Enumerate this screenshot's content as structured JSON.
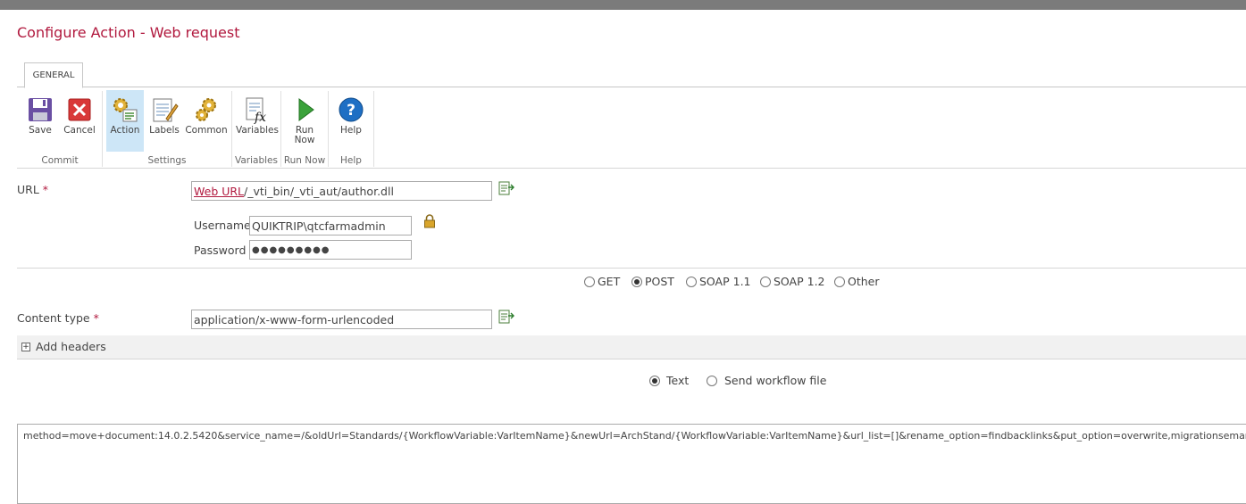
{
  "dialog": {
    "title": "Configure Action - Web request"
  },
  "ribbon": {
    "tab_label": "GENERAL",
    "buttons": {
      "save": "Save",
      "cancel": "Cancel",
      "action": "Action",
      "labels": "Labels",
      "common": "Common",
      "variables": "Variables",
      "run_now_line1": "Run",
      "run_now_line2": "Now",
      "help": "Help"
    },
    "groups": {
      "commit": "Commit",
      "settings": "Settings",
      "variables": "Variables",
      "run_now": "Run Now",
      "help": "Help"
    },
    "selected_button": "Action"
  },
  "form": {
    "url_label": "URL",
    "url_value_link": "Web URL",
    "url_value_rest": "/_vti_bin/_vti_aut/author.dll",
    "username_label": "Username",
    "username_value": "QUIKTRIP\\qtcfarmadmin",
    "password_label": "Password",
    "password_value": "●●●●●●●●●",
    "required_mark": "*",
    "methods": [
      {
        "label": "GET",
        "selected": false
      },
      {
        "label": "POST",
        "selected": true
      },
      {
        "label": "SOAP 1.1",
        "selected": false
      },
      {
        "label": "SOAP 1.2",
        "selected": false
      },
      {
        "label": "Other",
        "selected": false
      }
    ],
    "content_type_label": "Content type",
    "content_type_value": "application/x-www-form-urlencoded",
    "add_headers_label": "Add headers",
    "add_headers_toggle": "+",
    "body_modes": [
      {
        "label": "Text",
        "selected": true
      },
      {
        "label": "Send workflow file",
        "selected": false
      }
    ],
    "body_text": "method=move+document:14.0.2.5420&service_name=/&oldUrl=Standards/{WorkflowVariable:VarItemName}&newUrl=ArchStand/{WorkflowVariable:VarItemName}&url_list=[]&rename_option=findbacklinks&put_option=overwrite,migrationsemantics"
  },
  "colors": {
    "accent": "#b1193e",
    "selected_bg": "#cde6f7",
    "topbar": "#7b7b7b"
  }
}
